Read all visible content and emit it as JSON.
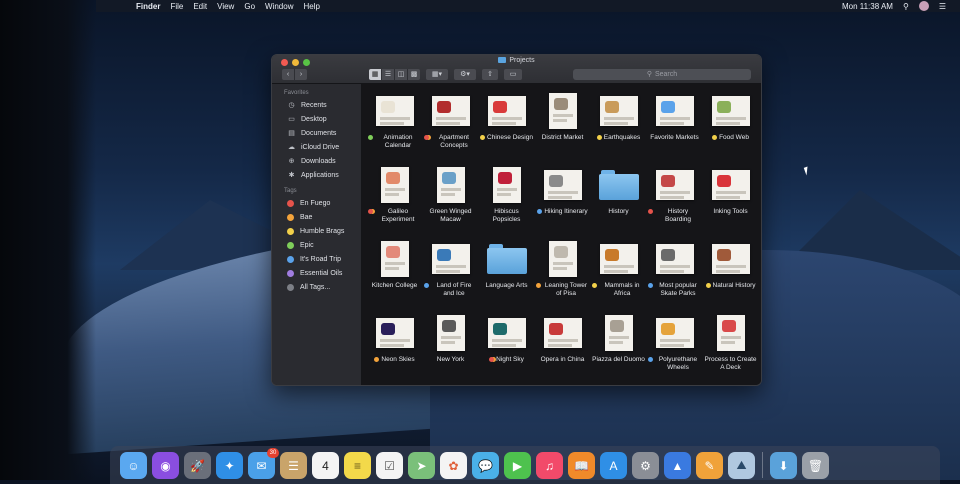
{
  "menubar": {
    "apple_glyph": "",
    "app_name": "Finder",
    "menus": [
      "File",
      "Edit",
      "View",
      "Go",
      "Window",
      "Help"
    ],
    "clock": "Mon 11:38 AM"
  },
  "window": {
    "title": "Projects",
    "search_placeholder": "Search",
    "nav_back": "‹",
    "nav_forward": "›"
  },
  "sidebar": {
    "favorites_heading": "Favorites",
    "favorites": [
      {
        "label": "Recents",
        "icon": "clock-icon"
      },
      {
        "label": "Desktop",
        "icon": "desktop-icon"
      },
      {
        "label": "Documents",
        "icon": "document-icon"
      },
      {
        "label": "iCloud Drive",
        "icon": "cloud-icon"
      },
      {
        "label": "Downloads",
        "icon": "download-icon"
      },
      {
        "label": "Applications",
        "icon": "applications-icon"
      }
    ],
    "tags_heading": "Tags",
    "tags": [
      {
        "label": "En Fuego",
        "color": "#e5534b"
      },
      {
        "label": "Bae",
        "color": "#f3a33b"
      },
      {
        "label": "Humble Brags",
        "color": "#f2d04a"
      },
      {
        "label": "Epic",
        "color": "#7fce5a"
      },
      {
        "label": "It's Road Trip",
        "color": "#5aa2ea"
      },
      {
        "label": "Essential Oils",
        "color": "#a07de0"
      },
      {
        "label": "All Tags...",
        "color": "#7c7f86"
      }
    ]
  },
  "files": [
    {
      "name": "Animation Calendar",
      "tag": "#7fce5a",
      "kind": "doc",
      "accent": "#e9e3d5"
    },
    {
      "name": "Apartment Concepts",
      "tag": "#e5534b",
      "tag2": true,
      "kind": "doc",
      "accent": "#b22d2d"
    },
    {
      "name": "Chinese Design",
      "tag": "#f2d04a",
      "kind": "doc",
      "accent": "#d93a3a"
    },
    {
      "name": "District Market",
      "tag": "",
      "kind": "doc-port",
      "accent": "#9a8c7a"
    },
    {
      "name": "Earthquakes",
      "tag": "#f2d04a",
      "kind": "doc",
      "accent": "#c99b5a"
    },
    {
      "name": "Favorite Markets",
      "tag": "",
      "kind": "doc",
      "accent": "#5aa2ea"
    },
    {
      "name": "Food Web",
      "tag": "#f2d04a",
      "kind": "doc",
      "accent": "#8bb05a"
    },
    {
      "name": "Galileo Experiment",
      "tag": "#e5534b",
      "tag2": true,
      "kind": "doc-port",
      "accent": "#e28a6a"
    },
    {
      "name": "Green Winged Macaw",
      "tag": "",
      "kind": "doc-port",
      "accent": "#6aa0c8"
    },
    {
      "name": "Hibiscus Popsicles",
      "tag": "",
      "kind": "doc-port",
      "accent": "#c0203a"
    },
    {
      "name": "Hiking Itinerary",
      "tag": "#5aa2ea",
      "kind": "doc",
      "accent": "#8a8a8a"
    },
    {
      "name": "History",
      "tag": "",
      "kind": "folder",
      "accent": "#5aa2da"
    },
    {
      "name": "History Boarding",
      "tag": "#e5534b",
      "kind": "doc",
      "accent": "#c44848"
    },
    {
      "name": "Inking Tools",
      "tag": "",
      "kind": "doc",
      "accent": "#d9343a"
    },
    {
      "name": "Kitchen College",
      "tag": "",
      "kind": "doc-port",
      "accent": "#e38a7a"
    },
    {
      "name": "Land of Fire and Ice",
      "tag": "#5aa2ea",
      "kind": "doc",
      "accent": "#3a7ab8"
    },
    {
      "name": "Language Arts",
      "tag": "",
      "kind": "folder",
      "accent": "#5aa2da"
    },
    {
      "name": "Leaning Tower of Pisa",
      "tag": "#f3a33b",
      "kind": "doc-port",
      "accent": "#bfb9ae"
    },
    {
      "name": "Mammals in Africa",
      "tag": "#f2d04a",
      "kind": "doc",
      "accent": "#c87a2a"
    },
    {
      "name": "Most popular Skate Parks",
      "tag": "#5aa2ea",
      "kind": "doc",
      "accent": "#6b6b6b"
    },
    {
      "name": "Natural History",
      "tag": "#f2d04a",
      "kind": "doc",
      "accent": "#a05a3a"
    },
    {
      "name": "Neon Skies",
      "tag": "#f3a33b",
      "kind": "doc",
      "accent": "#2a1f5a"
    },
    {
      "name": "New York",
      "tag": "",
      "kind": "doc-port",
      "accent": "#5a5a5a"
    },
    {
      "name": "Night Sky",
      "tag": "#e5534b",
      "tag2": true,
      "kind": "doc",
      "accent": "#1e6b6b"
    },
    {
      "name": "Opera in China",
      "tag": "",
      "kind": "doc",
      "accent": "#c83a3a"
    },
    {
      "name": "Piazza del Duomo",
      "tag": "",
      "kind": "doc-port",
      "accent": "#a8a094"
    },
    {
      "name": "Polyurethane Wheels",
      "tag": "#5aa2ea",
      "kind": "doc",
      "accent": "#e5a33b"
    },
    {
      "name": "Process to Create A Deck",
      "tag": "",
      "kind": "doc-port",
      "accent": "#d94a4a"
    }
  ],
  "dock": {
    "apps": [
      {
        "name": "finder-icon",
        "color": "#5aa8f0",
        "glyph": "☺"
      },
      {
        "name": "siri-icon",
        "color": "#8a4ee0",
        "glyph": "◉"
      },
      {
        "name": "launchpad-icon",
        "color": "#6a6f7a",
        "glyph": "🚀"
      },
      {
        "name": "safari-icon",
        "color": "#2f8fe6",
        "glyph": "✦"
      },
      {
        "name": "mail-icon",
        "color": "#4aa0e8",
        "glyph": "✉",
        "badge": "30"
      },
      {
        "name": "contacts-icon",
        "color": "#c9a46a",
        "glyph": "☰"
      },
      {
        "name": "calendar-icon",
        "color": "#f4f4f4",
        "glyph": "4",
        "text_color": "#222"
      },
      {
        "name": "notes-icon",
        "color": "#f3d94a",
        "glyph": "≡",
        "text_color": "#6a5a1a"
      },
      {
        "name": "reminders-icon",
        "color": "#f4f4f4",
        "glyph": "☑",
        "text_color": "#555"
      },
      {
        "name": "maps-icon",
        "color": "#7ac07a",
        "glyph": "➤"
      },
      {
        "name": "photos-icon",
        "color": "#f4f4f4",
        "glyph": "✿",
        "text_color": "#e0603a"
      },
      {
        "name": "messages-icon",
        "color": "#4ab0e8",
        "glyph": "💬"
      },
      {
        "name": "facetime-icon",
        "color": "#4ec24e",
        "glyph": "▶"
      },
      {
        "name": "music-icon",
        "color": "#f24a6a",
        "glyph": "♫"
      },
      {
        "name": "books-icon",
        "color": "#f08a2a",
        "glyph": "📖"
      },
      {
        "name": "app-store-icon",
        "color": "#2f8fe6",
        "glyph": "A"
      },
      {
        "name": "system-preferences-icon",
        "color": "#8a8e96",
        "glyph": "⚙"
      },
      {
        "name": "keynote-icon",
        "color": "#3a7ae0",
        "glyph": "▲"
      },
      {
        "name": "pages-icon",
        "color": "#f0a23a",
        "glyph": "✎"
      },
      {
        "name": "preview-icon",
        "color": "#b0c8e0",
        "glyph": "⛰",
        "text_color": "#2a4a6a"
      }
    ],
    "trailing": [
      {
        "name": "downloads-stack-icon",
        "color": "#5aa2da",
        "glyph": "⬇"
      },
      {
        "name": "trash-icon",
        "color": "#9aa0a8",
        "glyph": "🗑"
      }
    ]
  }
}
